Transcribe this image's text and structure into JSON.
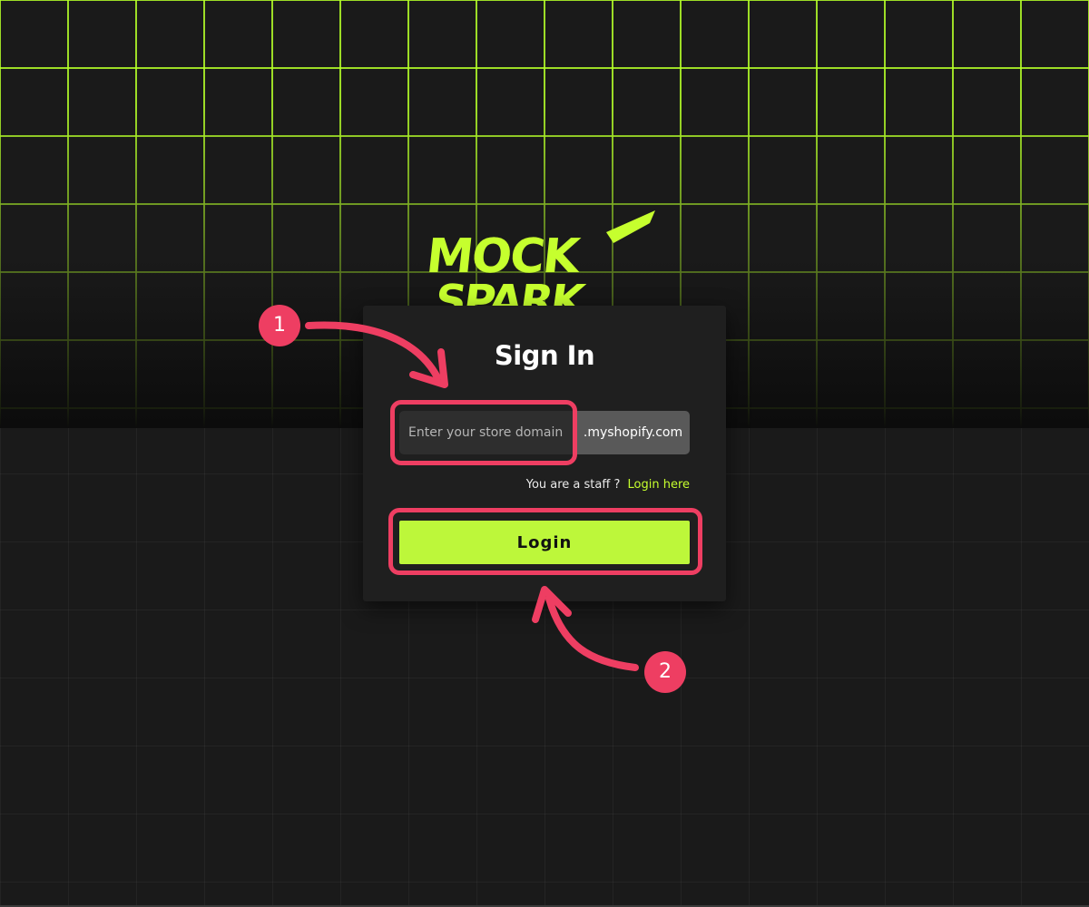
{
  "brand": {
    "logo_line1": "MOCK",
    "logo_line2": "SPARK",
    "accent_color": "#c6ff2e"
  },
  "signin": {
    "title": "Sign In",
    "domain_input": {
      "placeholder": "Enter your store domain",
      "value": ""
    },
    "domain_suffix": ".myshopify.com",
    "staff_prompt": "You are a staff ?",
    "staff_link": "Login here",
    "login_button": "Login"
  },
  "annotations": {
    "step1": "1",
    "step2": "2",
    "highlight_color": "#ee3e62"
  }
}
